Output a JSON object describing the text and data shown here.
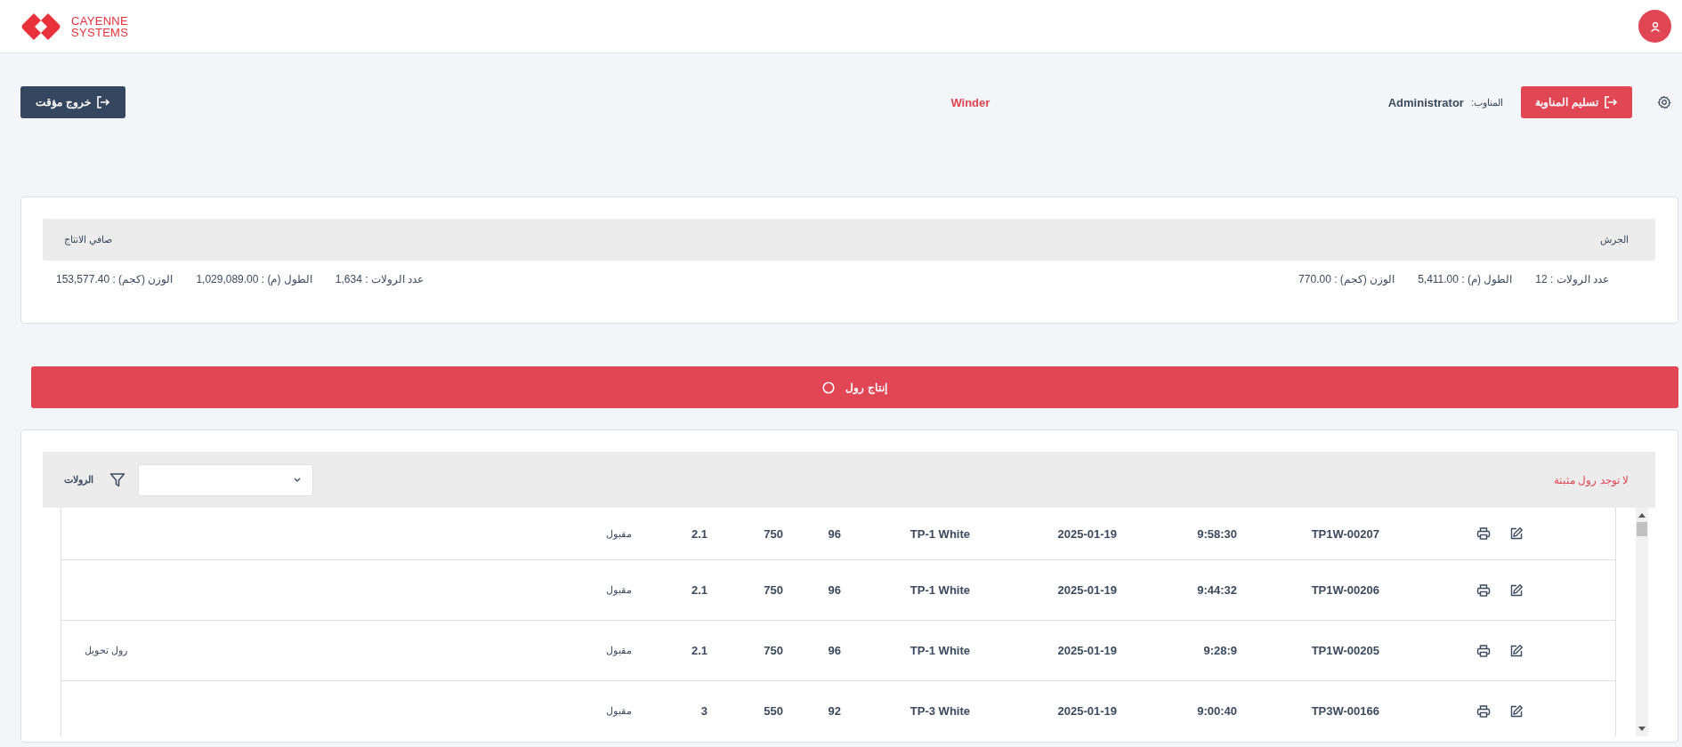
{
  "header": {
    "logo_lines": [
      "CAYENNE",
      "SYSTEMS"
    ]
  },
  "toolbar": {
    "temp_exit_button": "خروج مؤقت",
    "station": "Winder",
    "handover_button": "تسليم المناوبة",
    "operator_label": "المناوب:",
    "operator": "Administrator"
  },
  "summary": {
    "groups": [
      {
        "title": "الجرش",
        "stats": [
          "عدد الرولات : 12",
          "الطول (م) : 5,411.00",
          "الوزن (كجم) : 770.00"
        ]
      },
      {
        "title": "صافي الانتاج",
        "stats": [
          "عدد الرولات : 1,634",
          "الطول (م) : 1,029,089.00",
          "الوزن (كجم) : 153,577.40"
        ]
      }
    ]
  },
  "produce_button": "إنتاج رول",
  "rolls": {
    "message": "لا توجد رول مثبتة",
    "title": "الرولات",
    "rows": [
      {
        "cells": [
          "TP1W-00207",
          "9:58:30",
          "2025-01-19",
          "TP-1 White",
          "96",
          "750",
          "2.1",
          "مقبول"
        ]
      },
      {
        "cells": [
          "TP1W-00206",
          "9:44:32",
          "2025-01-19",
          "TP-1 White",
          "96",
          "750",
          "2.1",
          "مقبول"
        ]
      },
      {
        "cells": [
          "TP1W-00205",
          "9:28:9",
          "2025-01-19",
          "TP-1 White",
          "96",
          "750",
          "2.1",
          "مقبول"
        ],
        "note": "رول تحويل"
      },
      {
        "cells": [
          "TP3W-00166",
          "9:00:40",
          "2025-01-19",
          "TP-3 White",
          "92",
          "550",
          "3",
          "مقبول"
        ]
      }
    ]
  }
}
